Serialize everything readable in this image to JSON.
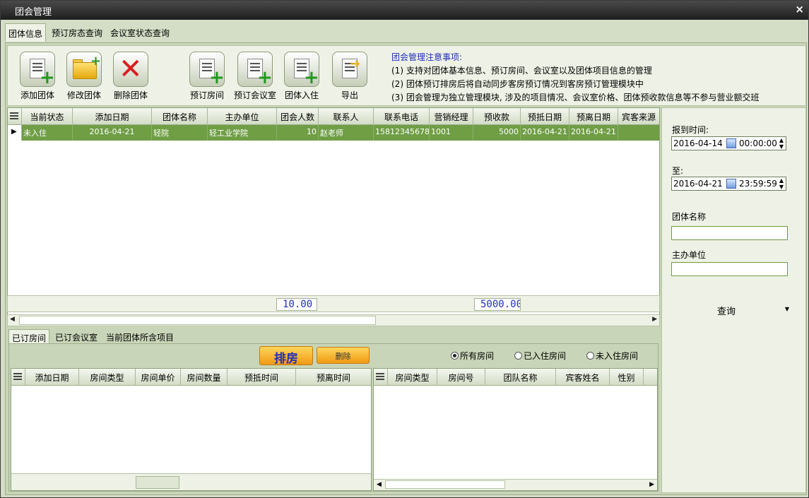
{
  "window": {
    "title": "团会管理",
    "close": "×"
  },
  "top_tabs": [
    "团体信息",
    "预订房态查询",
    "会议室状态查询"
  ],
  "toolbar": {
    "add_group": "添加团体",
    "edit_group": "修改团体",
    "delete_group": "删除团体",
    "book_room": "预订房间",
    "book_meeting": "预订会议室",
    "group_checkin": "团体入住",
    "export": "导出"
  },
  "notes": {
    "title": "团会管理注意事项:",
    "lines": [
      "(1) 支持对团体基本信息、预订房间、会议室以及团体项目信息的管理",
      "(2) 团体预订排房后将自动同步客房预订情况到客房预订管理模块中",
      "(3) 团会管理为独立管理模块, 涉及的项目情况、会议室价格、团体预收款信息等不参与营业额交班"
    ]
  },
  "main_grid": {
    "columns": [
      "当前状态",
      "添加日期",
      "团体名称",
      "主办单位",
      "团会人数",
      "联系人",
      "联系电话",
      "营销经理",
      "预收款",
      "预抵日期",
      "预离日期",
      "宾客来源"
    ],
    "rows": [
      [
        "未入住",
        "2016-04-21",
        "轻院",
        "轻工业学院",
        "10",
        "赵老师",
        "15812345678",
        "1001",
        "5000",
        "2016-04-21",
        "2016-04-21",
        ""
      ]
    ],
    "totals": {
      "people": "10.00",
      "deposit": "5000.00"
    }
  },
  "bottom_tabs": [
    "已订房间",
    "已订会议室",
    "当前团体所含项目"
  ],
  "bottom": {
    "arrange_button": "排房",
    "delete_button": "删除",
    "radios": [
      "所有房间",
      "已入住房间",
      "未入住房间"
    ],
    "left_columns": [
      "添加日期",
      "房间类型",
      "房间单价",
      "房间数量",
      "预抵时间",
      "预离时间"
    ],
    "right_columns": [
      "房间类型",
      "房间号",
      "团队名称",
      "宾客姓名",
      "性别"
    ]
  },
  "side": {
    "arrive_label": "报到时间:",
    "arrive_date": "2016-04-14",
    "arrive_time": "00:00:00",
    "to_label": "至:",
    "to_date": "2016-04-21",
    "to_time": "23:59:59",
    "group_name_label": "团体名称",
    "group_name_value": "",
    "host_label": "主办单位",
    "host_value": "",
    "query_button": "查询"
  }
}
